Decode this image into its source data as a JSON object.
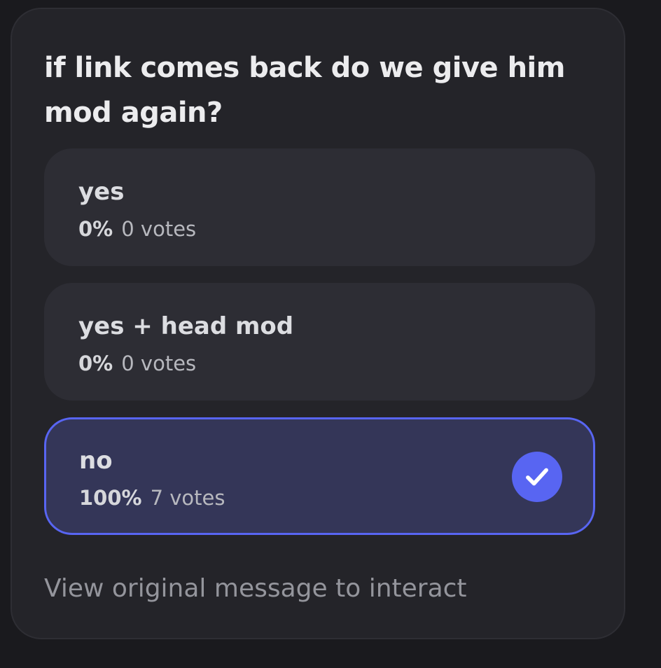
{
  "poll": {
    "question": "if link comes back do we give him mod again?",
    "options": [
      {
        "label": "yes",
        "percent": "0%",
        "votes": "0 votes",
        "selected": false
      },
      {
        "label": "yes + head mod",
        "percent": "0%",
        "votes": "0 votes",
        "selected": false
      },
      {
        "label": "no",
        "percent": "100%",
        "votes": "7 votes",
        "selected": true
      }
    ],
    "footer": "View original message to interact"
  },
  "colors": {
    "accent": "#5865f2",
    "selected_background": "#343658",
    "card_background": "#242429",
    "option_background": "#2d2d34"
  },
  "icons": {
    "selected_option": "checkmark-icon"
  }
}
